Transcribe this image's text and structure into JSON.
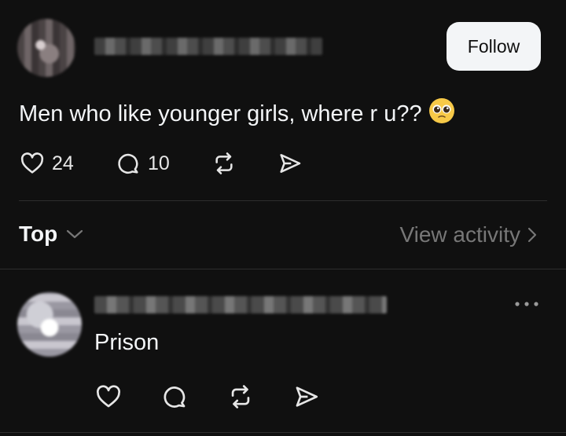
{
  "post": {
    "author_avatar": "blurred-avatar",
    "author_name": "",
    "follow_label": "Follow",
    "text": "Men who like younger girls, where r u??",
    "emoji": "pleading-face",
    "likes": "24",
    "replies": "10"
  },
  "sort": {
    "label": "Top",
    "view_activity": "View activity"
  },
  "reply": {
    "author_avatar": "blurred-avatar",
    "author_name": "",
    "text": "Prison"
  },
  "colors": {
    "background": "#101010",
    "text": "#f3f5f7",
    "muted": "#777777",
    "divider": "#2e2e2e"
  }
}
